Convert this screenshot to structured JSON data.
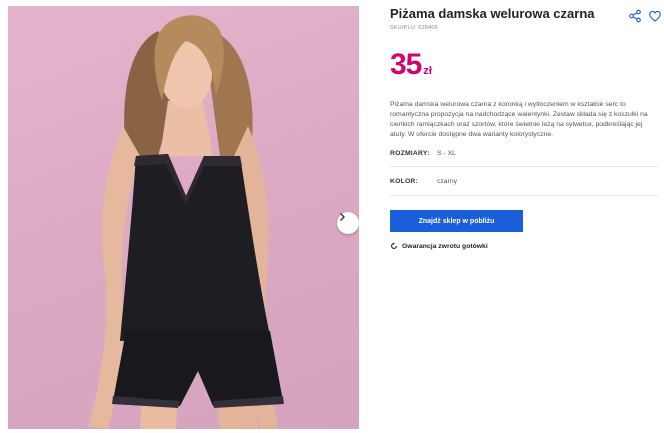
{
  "product": {
    "title": "Piżama damska welurowa czarna",
    "sku": "SKU/PLU: 628406",
    "price_amount": "35",
    "price_currency": "zł",
    "description": "Piżama damska welurowa czarna z koronką i wytłoczeniem w kształcie serc to romantyczna propozycja na nadchodzące walentynki. Zestaw składa się z koszulki na cienkich ramiączkach oraz szortów, które świetnie leżą na sylwetce, podkreślając jej atuty. W ofercie dostępne dwa warianty kolorystyczne.",
    "sizes_label": "ROZMIARY:",
    "sizes_value": "S - XL",
    "color_label": "KOLOR:",
    "color_value": "czarny"
  },
  "actions": {
    "find_store": "Znajdź sklep w pobliżu",
    "guarantee": "Gwarancja zwrotu gotówki"
  },
  "icons": {
    "share": "share-icon",
    "favorite": "heart-icon",
    "next": "chevron-right-icon",
    "refund": "refresh-icon"
  },
  "colors": {
    "price": "#d2046f",
    "button": "#1a5fd9",
    "photo_background": "#dcaac4"
  }
}
